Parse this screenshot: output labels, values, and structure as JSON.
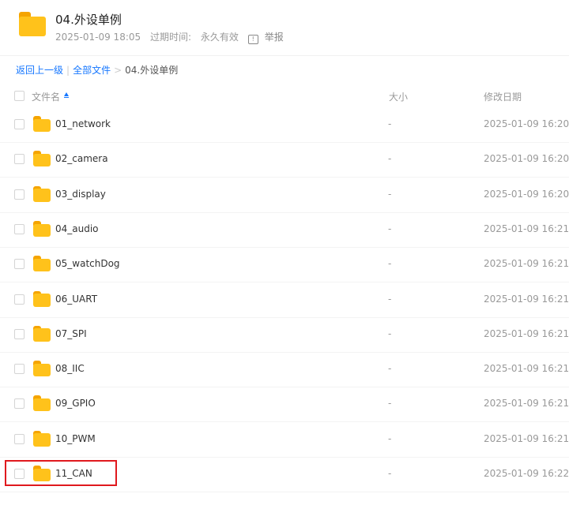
{
  "header": {
    "title": "04.外设单例",
    "date": "2025-01-09 18:05",
    "expire_label": "过期时间:",
    "expire_value": "永久有效",
    "report_label": "举报"
  },
  "breadcrumb": {
    "back": "返回上一级",
    "all_files": "全部文件",
    "current": "04.外设单例",
    "separator_pipe": "|",
    "separator_arrow": ">"
  },
  "list_header": {
    "name": "文件名",
    "size": "大小",
    "date": "修改日期"
  },
  "rows": [
    {
      "name": "01_network",
      "size": "-",
      "date": "2025-01-09 16:20"
    },
    {
      "name": "02_camera",
      "size": "-",
      "date": "2025-01-09 16:20"
    },
    {
      "name": "03_display",
      "size": "-",
      "date": "2025-01-09 16:20"
    },
    {
      "name": "04_audio",
      "size": "-",
      "date": "2025-01-09 16:21"
    },
    {
      "name": "05_watchDog",
      "size": "-",
      "date": "2025-01-09 16:21"
    },
    {
      "name": "06_UART",
      "size": "-",
      "date": "2025-01-09 16:21"
    },
    {
      "name": "07_SPI",
      "size": "-",
      "date": "2025-01-09 16:21"
    },
    {
      "name": "08_IIC",
      "size": "-",
      "date": "2025-01-09 16:21"
    },
    {
      "name": "09_GPIO",
      "size": "-",
      "date": "2025-01-09 16:21"
    },
    {
      "name": "10_PWM",
      "size": "-",
      "date": "2025-01-09 16:21"
    },
    {
      "name": "11_CAN",
      "size": "-",
      "date": "2025-01-09 16:22"
    }
  ],
  "colors": {
    "link": "#1677ff",
    "folder": "#ffc21b",
    "highlight": "#e0191e"
  }
}
